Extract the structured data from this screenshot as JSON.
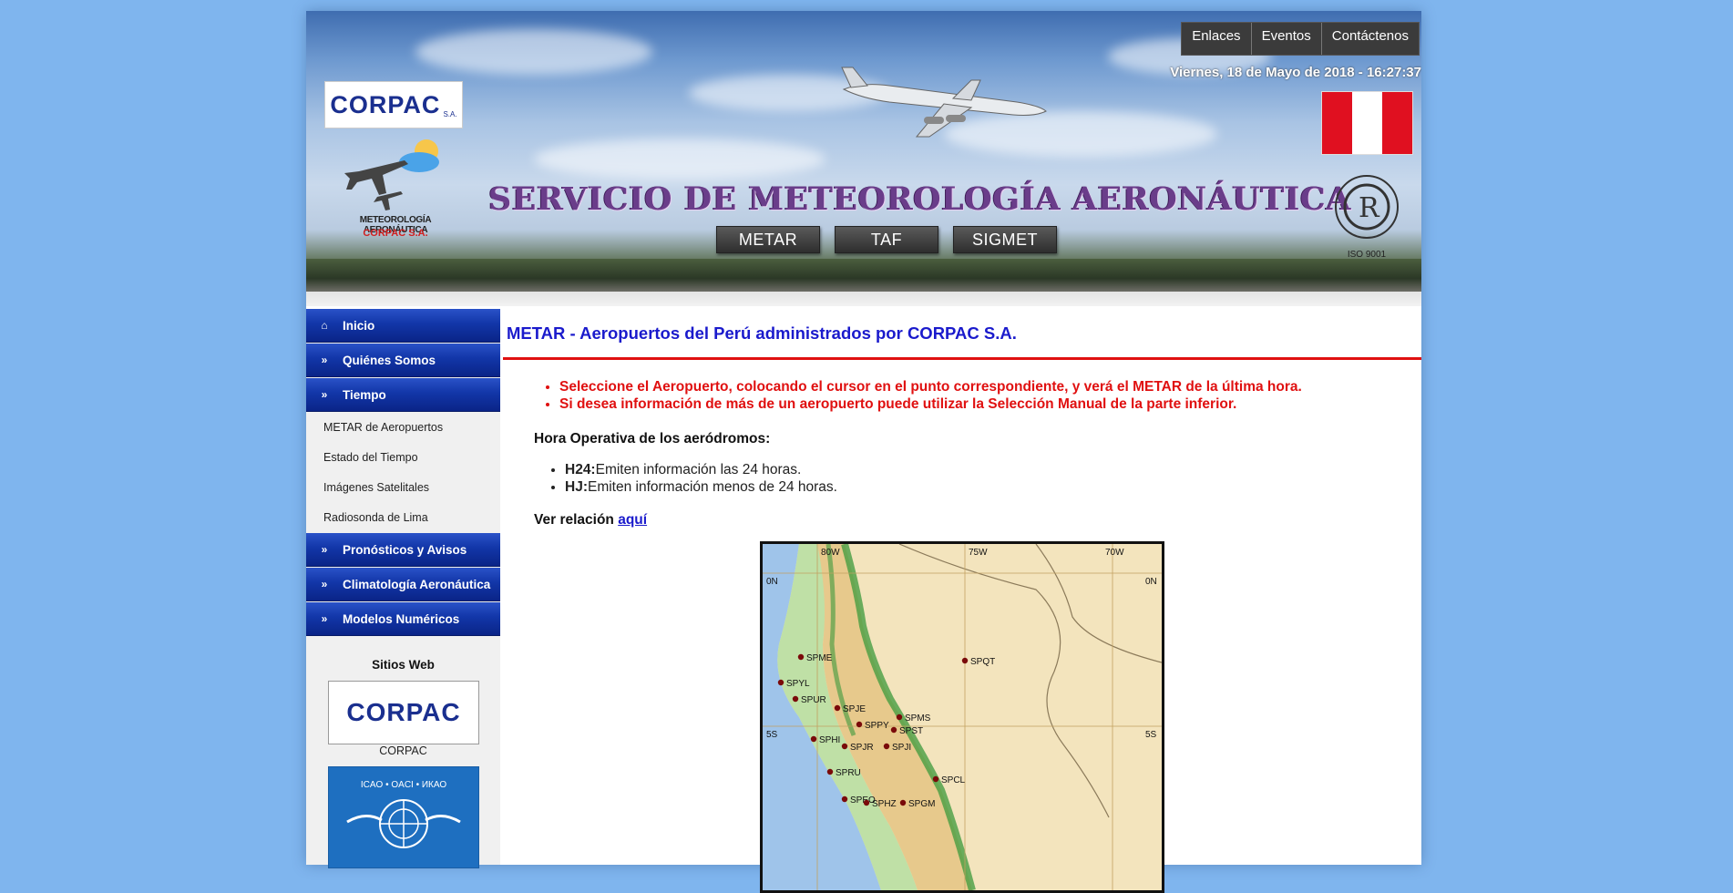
{
  "header": {
    "top_nav": [
      "Enlaces",
      "Eventos",
      "Contáctenos"
    ],
    "datetime": "Viernes, 18 de Mayo de 2018 - 16:27:37",
    "logo_text": "CORPAC",
    "logo_sa": "S.A.",
    "meteo_logo_line1": "METEOROLOGÍA AERONÁUTICA",
    "meteo_logo_line2": "CORPAC S.A.",
    "title": "SERVICIO DE METEOROLOGÍA AERONÁUTICA",
    "buttons": [
      "METAR",
      "TAF",
      "SIGMET"
    ],
    "iso_text": "ISO 9001",
    "colors": {
      "flag_red": "#e01020",
      "flag_white": "#ffffff"
    }
  },
  "sidebar": {
    "menu": [
      {
        "label": "Inicio",
        "icon": "home-icon",
        "type": "main"
      },
      {
        "label": "Quiénes Somos",
        "icon": "double-chevron-right-icon",
        "type": "main"
      },
      {
        "label": "Tiempo",
        "icon": "double-chevron-right-icon",
        "type": "main"
      },
      {
        "label": "METAR de Aeropuertos",
        "type": "sub"
      },
      {
        "label": "Estado del Tiempo",
        "type": "sub"
      },
      {
        "label": "Imágenes Satelitales",
        "type": "sub"
      },
      {
        "label": "Radiosonda de Lima",
        "type": "sub"
      },
      {
        "label": "Pronósticos y Avisos",
        "icon": "double-chevron-right-icon",
        "type": "main"
      },
      {
        "label": "Climatología Aeronáutica",
        "icon": "double-chevron-right-icon",
        "type": "main"
      },
      {
        "label": "Modelos Numéricos",
        "icon": "double-chevron-right-icon",
        "type": "main"
      }
    ],
    "sites_title": "Sitios Web",
    "sites": [
      {
        "label": "CORPAC"
      }
    ],
    "icao_text": "ICAO • OACI • ИКАО"
  },
  "main": {
    "title": "METAR - Aeropuertos del Perú administrados por CORPAC S.A.",
    "bullets": [
      "Seleccione el Aeropuerto, colocando el cursor en el punto correspondiente, y verá el METAR de la última hora.",
      "Si desea información de más de un aeropuerto puede utilizar la Selección Manual de la parte inferior."
    ],
    "hora_title": "Hora Operativa de los aeródromos:",
    "hora_items": [
      {
        "code": "H24:",
        "text": "Emiten información las 24 horas."
      },
      {
        "code": "HJ:",
        "text": "Emiten información menos de 24 horas."
      }
    ],
    "ver_relacion": "Ver relación",
    "ver_link": "aquí"
  },
  "map": {
    "lon_labels": [
      "80W",
      "75W",
      "70W"
    ],
    "lat_labels": [
      "0N",
      "0N",
      "5S",
      "5S"
    ],
    "airports": [
      "SPME",
      "SPYL",
      "SPUR",
      "SPJE",
      "SPPY",
      "SPMS",
      "SPST",
      "SPHI",
      "SPJR",
      "SPJI",
      "SPRU",
      "SPCL",
      "SPEO",
      "SPHZ",
      "SPGM",
      "SPQT"
    ]
  }
}
